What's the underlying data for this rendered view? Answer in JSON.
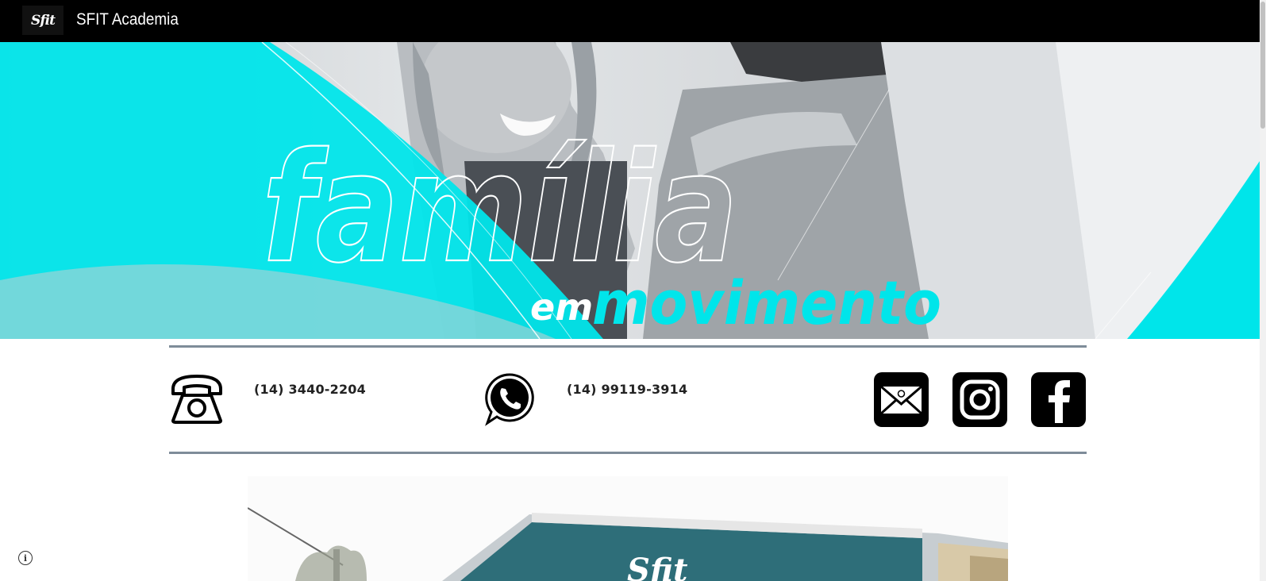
{
  "header": {
    "logo_text": "Sfit",
    "site_title": "SFIT Academia"
  },
  "hero": {
    "headline_word": "família",
    "tagline_prefix": "em",
    "tagline_word": "movimento",
    "accent_color": "#00e5ea"
  },
  "contacts": {
    "phone": "(14) 3440-2204",
    "whatsapp": "(14) 99119-3914"
  },
  "social": [
    "email-icon",
    "instagram-icon",
    "facebook-icon"
  ],
  "storefront": {
    "sign_text": "Sfit"
  },
  "footer": {
    "info_label": "i"
  }
}
